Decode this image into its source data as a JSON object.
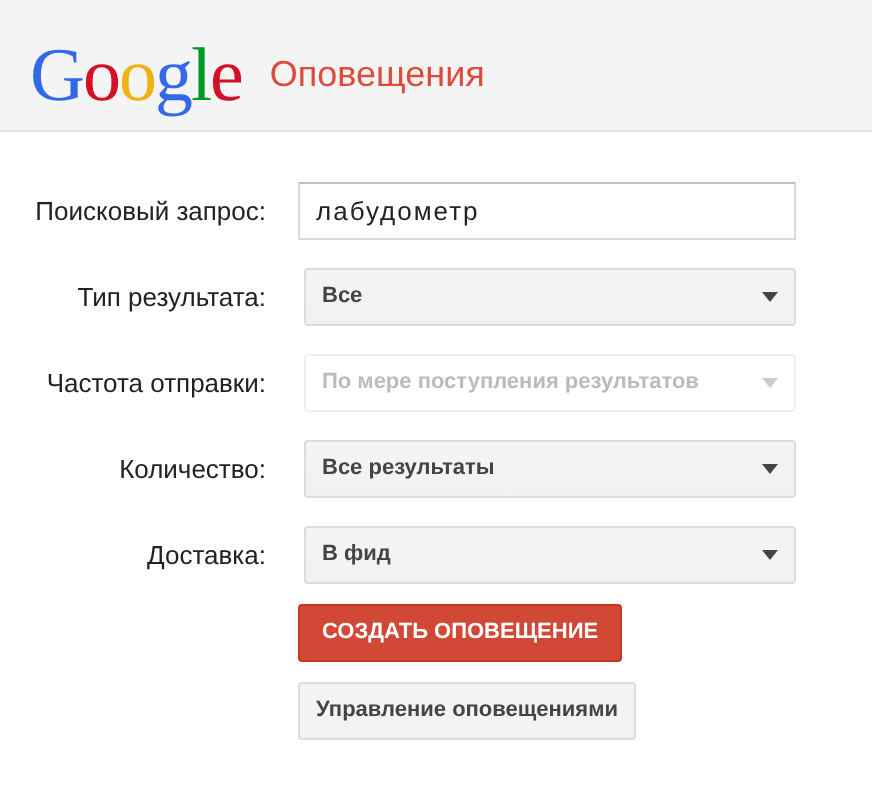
{
  "header": {
    "logo": [
      {
        "text": "G",
        "color": "#3369e8"
      },
      {
        "text": "o",
        "color": "#d50f25"
      },
      {
        "text": "o",
        "color": "#eeb211"
      },
      {
        "text": "g",
        "color": "#3369e8"
      },
      {
        "text": "l",
        "color": "#009925"
      },
      {
        "text": "e",
        "color": "#d50f25"
      }
    ],
    "title": "Оповещения"
  },
  "fields": [
    {
      "label": "Поисковый запрос:",
      "kind": "text",
      "value": "лабудометр",
      "disabled": false
    },
    {
      "label": "Тип результата:",
      "kind": "select",
      "value": "Все",
      "disabled": false
    },
    {
      "label": "Частота отправки:",
      "kind": "select",
      "value": "По мере поступления результатов",
      "disabled": true
    },
    {
      "label": "Количество:",
      "kind": "select",
      "value": "Все результаты",
      "disabled": false
    },
    {
      "label": "Доставка:",
      "kind": "select",
      "value": "В фид",
      "disabled": false
    }
  ],
  "buttons": [
    {
      "label": "СОЗДАТЬ ОПОВЕЩЕНИЕ",
      "kind": "primary"
    },
    {
      "label": "Управление оповещениями",
      "kind": "secondary"
    }
  ]
}
